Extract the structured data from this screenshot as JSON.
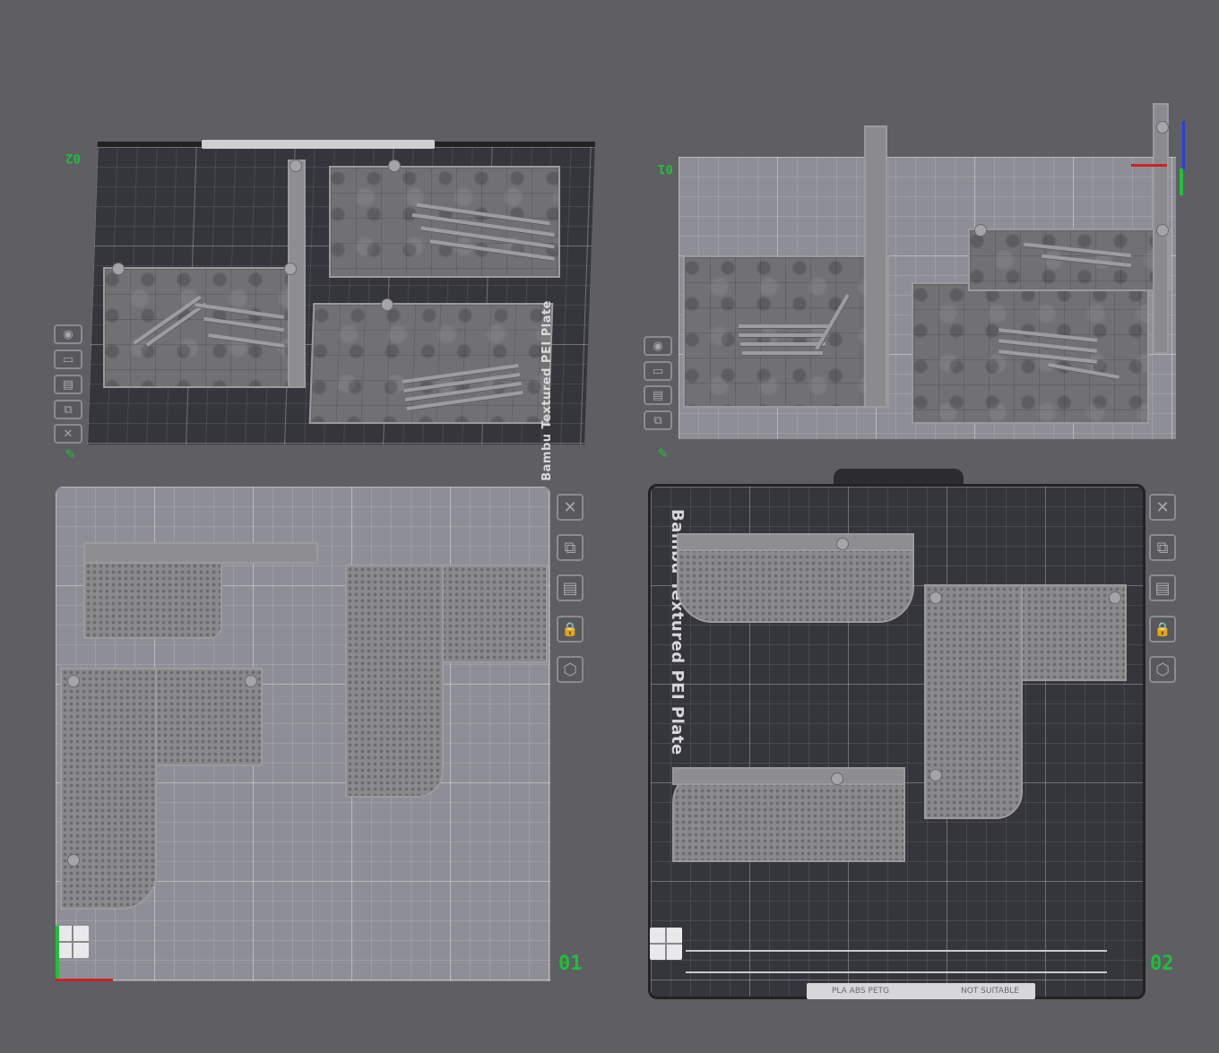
{
  "views": {
    "top_left": {
      "label": "02"
    },
    "top_right": {
      "label": "01"
    },
    "bottom_left": {
      "label": "01"
    },
    "bottom_right": {
      "label": "02"
    }
  },
  "plate": {
    "name": "Bambu Textured PEI Plate",
    "bar_text": "PLA ABS PETG",
    "bar_right": "NOT SUITABLE"
  },
  "toolbar": {
    "icons": [
      "close-icon",
      "auto-orient-icon",
      "arrange-icon",
      "lock-icon",
      "settings-icon"
    ],
    "glyphs": {
      "close": "✕",
      "orient": "⧉",
      "arrange": "▤",
      "lock": "🔒",
      "settings": "⬡",
      "eye": "◉",
      "edit": "✎"
    }
  },
  "colors": {
    "background": "#5e5e63",
    "label": "#1fbf3a",
    "light_plate": "#8e8f96",
    "dark_plate": "#35363b"
  }
}
